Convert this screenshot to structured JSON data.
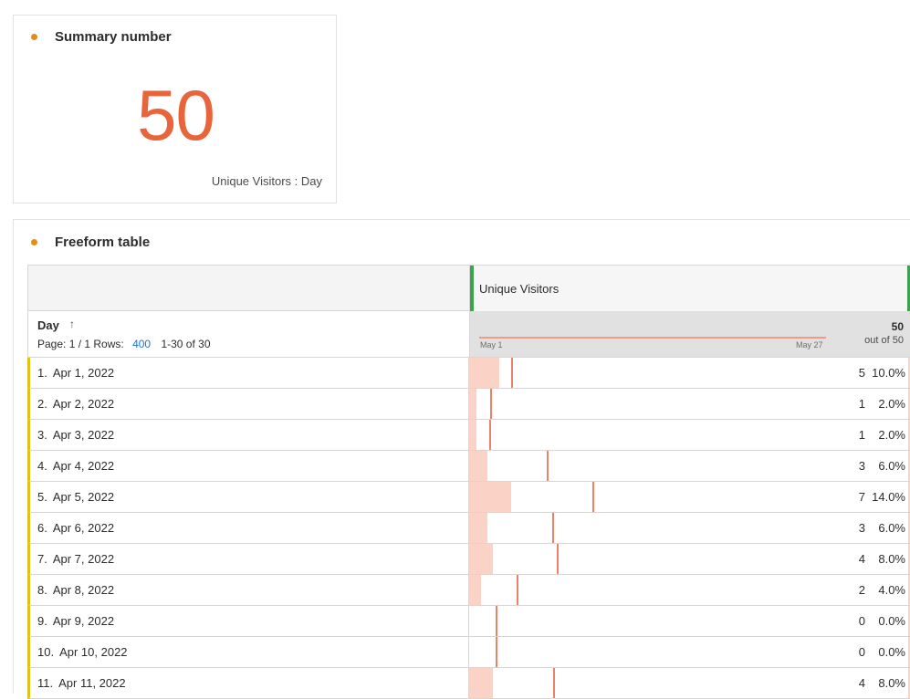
{
  "colors": {
    "accent_dot": "#e08c1e",
    "summary_value": "#e8643a",
    "bar": "#fad2c6",
    "marker": "#e8836a",
    "row_accent": "#e0c01a",
    "column_grip": "#3fa34d",
    "link": "#1473e6"
  },
  "summary_panel": {
    "title": "Summary number",
    "value": "50",
    "subtitle": "Unique Visitors : Day"
  },
  "table_panel": {
    "title": "Freeform table",
    "metric_header": "Unique Visitors",
    "dimension": "Day",
    "sort_icon": "arrow-up-icon",
    "pager": {
      "page": "Page: 1 / 1",
      "rows_label": "Rows:",
      "rows_value": "400",
      "range": "1-30 of 30"
    },
    "sparkline": {
      "start": "May 1",
      "end": "May 27"
    },
    "total": "50",
    "total_sub": "out of 50",
    "max_value": 50,
    "rows": [
      {
        "num": "1.",
        "day": "Apr 1, 2022",
        "value": "5",
        "pct": "10.0%",
        "v": 5
      },
      {
        "num": "2.",
        "day": "Apr 2, 2022",
        "value": "1",
        "pct": "2.0%",
        "v": 1
      },
      {
        "num": "3.",
        "day": "Apr 3, 2022",
        "value": "1",
        "pct": "2.0%",
        "v": 1
      },
      {
        "num": "4.",
        "day": "Apr 4, 2022",
        "value": "3",
        "pct": "6.0%",
        "v": 3
      },
      {
        "num": "5.",
        "day": "Apr 5, 2022",
        "value": "7",
        "pct": "14.0%",
        "v": 7
      },
      {
        "num": "6.",
        "day": "Apr 6, 2022",
        "value": "3",
        "pct": "6.0%",
        "v": 3
      },
      {
        "num": "7.",
        "day": "Apr 7, 2022",
        "value": "4",
        "pct": "8.0%",
        "v": 4
      },
      {
        "num": "8.",
        "day": "Apr 8, 2022",
        "value": "2",
        "pct": "4.0%",
        "v": 2
      },
      {
        "num": "9.",
        "day": "Apr 9, 2022",
        "value": "0",
        "pct": "0.0%",
        "v": 0
      },
      {
        "num": "10.",
        "day": "Apr 10, 2022",
        "value": "0",
        "pct": "0.0%",
        "v": 0
      },
      {
        "num": "11.",
        "day": "Apr 11, 2022",
        "value": "4",
        "pct": "8.0%",
        "v": 4
      }
    ]
  }
}
